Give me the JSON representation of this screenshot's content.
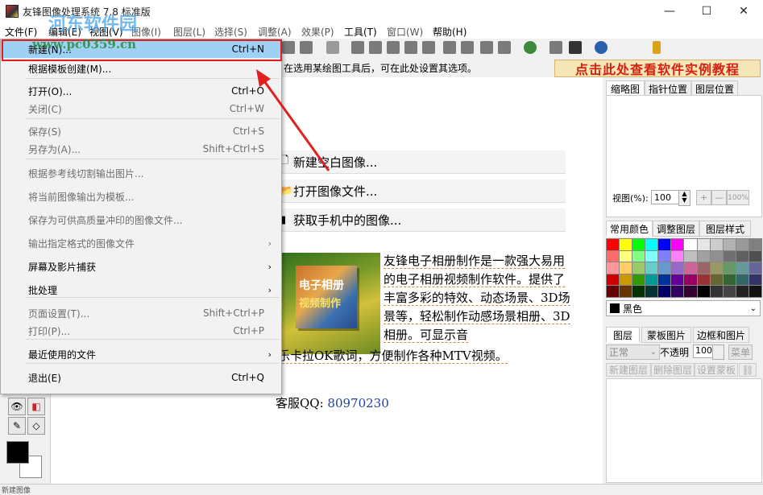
{
  "window": {
    "title": "友锋图像处理系统 7.8 标准版",
    "controls": {
      "minimize": "—",
      "maximize": "☐",
      "close": "✕"
    }
  },
  "watermark": {
    "line1": "河东软件园",
    "line2": "www.pc0359.cn"
  },
  "menubar": {
    "items": [
      "文件(F)",
      "编辑(E)",
      "视图(V)",
      "图像(I)",
      "图层(L)",
      "选择(S)",
      "调整(A)",
      "效果(P)",
      "工具(T)",
      "窗口(W)",
      "帮助(H)"
    ]
  },
  "hint": "在选用某绘图工具后，可在此处设置其选项。",
  "tutorial_banner": "点击此处查看软件实例教程",
  "file_menu": {
    "items": [
      {
        "label": "新建(N)...",
        "shortcut": "Ctrl+N",
        "state": "highlighted"
      },
      {
        "label": "根据模板创建(M)...",
        "shortcut": "",
        "state": "enabled"
      },
      {
        "label": "打开(O)...",
        "shortcut": "Ctrl+O",
        "state": "enabled"
      },
      {
        "label": "关闭(C)",
        "shortcut": "Ctrl+W",
        "state": "disabled"
      },
      {
        "label": "保存(S)",
        "shortcut": "Ctrl+S",
        "state": "disabled"
      },
      {
        "label": "另存为(A)...",
        "shortcut": "Shift+Ctrl+S",
        "state": "disabled"
      },
      {
        "label": "根据参考线切割输出图片...",
        "shortcut": "",
        "state": "disabled"
      },
      {
        "label": "将当前图像输出为模板...",
        "shortcut": "",
        "state": "disabled"
      },
      {
        "label": "保存为可供高质量冲印的图像文件...",
        "shortcut": "",
        "state": "disabled"
      },
      {
        "label": "输出指定格式的图像文件",
        "shortcut": "",
        "state": "disabled",
        "submenu": true
      },
      {
        "label": "屏幕及影片捕获",
        "shortcut": "",
        "state": "enabled",
        "submenu": true
      },
      {
        "label": "批处理",
        "shortcut": "",
        "state": "enabled",
        "submenu": true
      },
      {
        "label": "页面设置(T)...",
        "shortcut": "Shift+Ctrl+P",
        "state": "disabled"
      },
      {
        "label": "打印(P)...",
        "shortcut": "Ctrl+P",
        "state": "disabled"
      },
      {
        "label": "最近使用的文件",
        "shortcut": "",
        "state": "enabled",
        "submenu": true
      },
      {
        "label": "退出(E)",
        "shortcut": "Ctrl+Q",
        "state": "enabled"
      }
    ]
  },
  "start_links": [
    {
      "icon": "new-file-icon",
      "label": "新建空白图像..."
    },
    {
      "icon": "open-folder-icon",
      "label": "打开图像文件..."
    },
    {
      "icon": "phone-icon",
      "label": "获取手机中的图像..."
    }
  ],
  "promo": {
    "image_title": "电子相册",
    "image_subtitle": "视频制作",
    "description": "友锋电子相册制作是一款强大易用的电子相册视频制作软件。提供了丰富多彩的特效、动态场景、3D场景等，轻松制作动感场景相册、3D相册。可显示音",
    "description_tail": "乐卡拉OK歌词，方便制作各种MTV视频。",
    "qq_label": "客服QQ: ",
    "qq_number": "80970230"
  },
  "right_panel": {
    "top_tabs": [
      "缩略图",
      "指针位置",
      "图层位置"
    ],
    "zoom_label": "视图(%):",
    "zoom_value": "100",
    "zoom_buttons": [
      "+",
      "—",
      "100%"
    ],
    "color_tabs": [
      "常用颜色",
      "调整图层",
      "图层样式"
    ],
    "selected_color": "黑色",
    "layer_tabs": [
      "图层",
      "蒙板图片",
      "边框和图片"
    ],
    "blend_mode": "正常",
    "opacity_label": "不透明",
    "opacity_value": "100",
    "menu_button": "菜单",
    "layer_buttons": [
      "新建图层",
      "删除图层",
      "设置蒙板"
    ]
  },
  "palette": [
    "#ff0000",
    "#ffff00",
    "#00ff00",
    "#00ffff",
    "#0000ff",
    "#ff00ff",
    "#ffffff",
    "#e6e6e6",
    "#cccccc",
    "#b3b3b3",
    "#999999",
    "#808080",
    "#ff6a6a",
    "#ffff80",
    "#80ff80",
    "#80ffff",
    "#8080ff",
    "#ff80ff",
    "#c0c0c0",
    "#a0a0a0",
    "#909090",
    "#707070",
    "#606060",
    "#505050",
    "#ff9999",
    "#ffcc66",
    "#99cc66",
    "#66cccc",
    "#6699cc",
    "#9966cc",
    "#cc6699",
    "#996666",
    "#999966",
    "#669966",
    "#669999",
    "#666699",
    "#cc0000",
    "#cc9900",
    "#339900",
    "#009999",
    "#003399",
    "#660099",
    "#990066",
    "#993333",
    "#666633",
    "#336633",
    "#336666",
    "#333366",
    "#660000",
    "#663300",
    "#003300",
    "#003333",
    "#000066",
    "#330066",
    "#330033",
    "#000000",
    "#333333",
    "#444444",
    "#222222",
    "#111111"
  ],
  "status_text": "新建图像"
}
